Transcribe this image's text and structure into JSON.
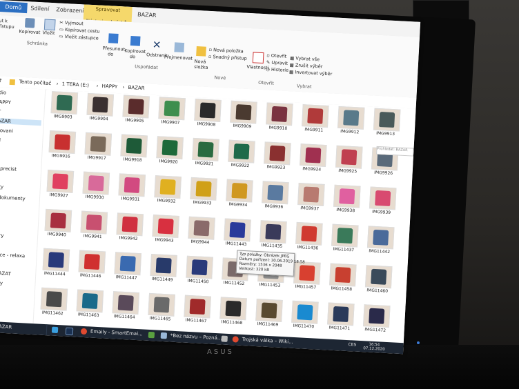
{
  "ribbon": {
    "tabs": [
      "Domů",
      "Sdílení",
      "Zobrazení",
      "Spravovat"
    ],
    "contextual_subtitle": "Nástroje obrázků",
    "window_title": "BAZAR",
    "left_partial": [
      "ut k",
      "řístupu"
    ],
    "copy": "Kopírovat",
    "paste": "Vložit",
    "cut": "Vyjmout",
    "copy_path": "Kopírovat cestu",
    "paste_shortcut": "Vložit zástupce",
    "clipboard_group": "Schránka",
    "move_to": [
      "Přesunout",
      "do"
    ],
    "copy_to": [
      "Kopírovat",
      "do"
    ],
    "delete": "Odstranit",
    "rename": "Přejmenovat",
    "organize_group": "Uspořádat",
    "new_folder": [
      "Nová",
      "složka"
    ],
    "new_item": "Nová položka",
    "easy_access": "Snadný přístup",
    "new_group": "Nové",
    "properties": "Vlastnosti",
    "open": "Otevřít",
    "edit": "Upravit",
    "history": "Historie",
    "open_group": "Otevřít",
    "select_all": "Vybrat vše",
    "select_none": "Zrušit výběr",
    "invert_selection": "Invertovat výběr",
    "select_group": "Vybrat"
  },
  "address": {
    "path": [
      "Tento počítač",
      "1 TERA (E:)",
      "HAPPY",
      "BAZAR"
    ],
    "search_placeholder": "Prohledat: BAZAR"
  },
  "sidebar": {
    "items": [
      "udio",
      "HAPPY",
      "RT",
      "BAZAR",
      "ogovani",
      "vid",
      "TI",
      "IO",
      "hy_precist",
      "JE",
      "AZKY",
      "na-dokumenty",
      "kty",
      "ky",
      "21",
      "né hry",
      "ety",
      "editace - relaxa",
      "Files",
      "A SMAZAT",
      "oubory",
      "ary",
      "s",
      "pps"
    ],
    "selected_index": 3
  },
  "files": [
    {
      "name": "IMG9903",
      "color": "#2f6a52"
    },
    {
      "name": "IMG9904",
      "color": "#3a3030"
    },
    {
      "name": "IMG9905",
      "color": "#5a2c2c"
    },
    {
      "name": "IMG9907",
      "color": "#3e8e4e"
    },
    {
      "name": "IMG9908",
      "color": "#2a2a2a"
    },
    {
      "name": "IMG9909",
      "color": "#4a3a30"
    },
    {
      "name": "IMG9910",
      "color": "#7a3340"
    },
    {
      "name": "IMG9911",
      "color": "#b03a3a"
    },
    {
      "name": "IMG9912",
      "color": "#5a7a8a"
    },
    {
      "name": "IMG9913",
      "color": "#4a5a5a"
    },
    {
      "name": "IMG9916",
      "color": "#c83030"
    },
    {
      "name": "IMG9917",
      "color": "#7a6a5a"
    },
    {
      "name": "IMG9918",
      "color": "#1e5a38"
    },
    {
      "name": "IMG9920",
      "color": "#1e6a3a"
    },
    {
      "name": "IMG9921",
      "color": "#2a6a40"
    },
    {
      "name": "IMG9922",
      "color": "#1e6a4a"
    },
    {
      "name": "IMG9923",
      "color": "#8a3030"
    },
    {
      "name": "IMG9924",
      "color": "#a03050"
    },
    {
      "name": "IMG9925",
      "color": "#c04050"
    },
    {
      "name": "IMG9926",
      "color": "#5a6a7a"
    },
    {
      "name": "IMG9927",
      "color": "#e04060"
    },
    {
      "name": "IMG9930",
      "color": "#d86a9a"
    },
    {
      "name": "IMG9931",
      "color": "#d24a80"
    },
    {
      "name": "IMG9932",
      "color": "#e0b020"
    },
    {
      "name": "IMG9933",
      "color": "#d0a018"
    },
    {
      "name": "IMG9934",
      "color": "#d09820"
    },
    {
      "name": "IMG9936",
      "color": "#5a7aa0"
    },
    {
      "name": "IMG9937",
      "color": "#b87a70"
    },
    {
      "name": "IMG9938",
      "color": "#e060a0"
    },
    {
      "name": "IMG9939",
      "color": "#d84a70"
    },
    {
      "name": "IMG9940",
      "color": "#a83040"
    },
    {
      "name": "IMG9941",
      "color": "#c85070"
    },
    {
      "name": "IMG9942",
      "color": "#d03040"
    },
    {
      "name": "IMG9943",
      "color": "#d83040"
    },
    {
      "name": "IMG9944",
      "color": "#8a6a6a"
    },
    {
      "name": "IMG11443",
      "color": "#2a3a9a"
    },
    {
      "name": "IMG11435",
      "color": "#3a3a5a"
    },
    {
      "name": "IMG11436",
      "color": "#d03a30"
    },
    {
      "name": "IMG11437",
      "color": "#3a7a5a"
    },
    {
      "name": "IMG11442",
      "color": "#4a6a9a"
    },
    {
      "name": "IMG11444",
      "color": "#2a3a7a"
    },
    {
      "name": "IMG11446",
      "color": "#d03030"
    },
    {
      "name": "IMG11447",
      "color": "#3a6ab0"
    },
    {
      "name": "IMG11449",
      "color": "#283a6a"
    },
    {
      "name": "IMG11450",
      "color": "#2a3a7a"
    },
    {
      "name": "IMG11452",
      "color": "#7a6a6a"
    },
    {
      "name": "IMG11453",
      "color": "#8a8a8a"
    },
    {
      "name": "IMG11457",
      "color": "#d84030"
    },
    {
      "name": "IMG11458",
      "color": "#c84030"
    },
    {
      "name": "IMG11460",
      "color": "#3a4a5a"
    },
    {
      "name": "IMG11462",
      "color": "#4a4a4a"
    },
    {
      "name": "IMG11463",
      "color": "#1a6a8a"
    },
    {
      "name": "IMG11464",
      "color": "#5a4a5a"
    },
    {
      "name": "IMG11465",
      "color": "#6a6a6a"
    },
    {
      "name": "IMG11467",
      "color": "#a02a2a"
    },
    {
      "name": "IMG11468",
      "color": "#2a2a2a"
    },
    {
      "name": "IMG11469",
      "color": "#5a4a30"
    },
    {
      "name": "IMG11470",
      "color": "#1a8ad0"
    },
    {
      "name": "IMG11471",
      "color": "#2a3a5a"
    },
    {
      "name": "IMG11472",
      "color": "#2a2a4a"
    }
  ],
  "tooltip": {
    "lines": [
      "Typ položky: Obrázek JPEG",
      "Datum pořízení: 30.06.2019 18:58",
      "Rozměry: 1536 x 2048",
      "Velikost: 320 kB"
    ]
  },
  "taskbar": {
    "folder": "BAZAR",
    "items": [
      "Emaily - SmartEmai...",
      "*Bez názvu – Pozná...",
      "Trojská válka – Wiki..."
    ],
    "lang": "CES",
    "time": "16:54",
    "date": "07.12.2020"
  }
}
